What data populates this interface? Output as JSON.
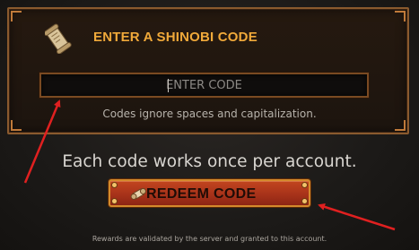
{
  "dialog": {
    "title": "ENTER A SHINOBI CODE",
    "title_icon": "scroll-icon",
    "code_input": {
      "placeholder": "ENTER CODE",
      "value": ""
    },
    "hint": "Codes ignore spaces and capitalization."
  },
  "notice": "Each code works once per account.",
  "redeem_button": {
    "label": "REDEEM CODE",
    "icon": "scroll-icon"
  },
  "footer": "Rewards are validated by the server and granted to this account.",
  "colors": {
    "accent": "#f0a93a",
    "button": "#b23a1c",
    "annotation": "#e02020"
  }
}
